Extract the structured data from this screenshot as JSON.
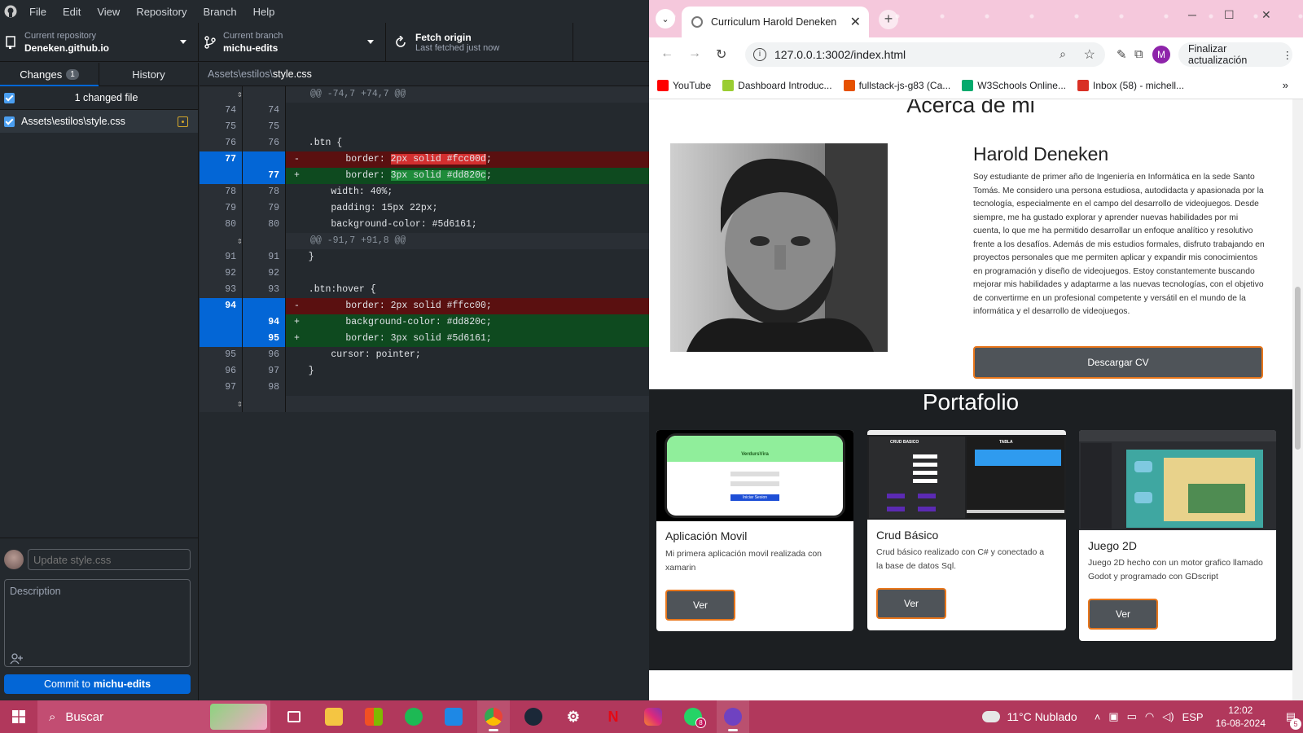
{
  "github_desktop": {
    "menu": [
      "File",
      "Edit",
      "View",
      "Repository",
      "Branch",
      "Help"
    ],
    "repo": {
      "label": "Current repository",
      "value": "Deneken.github.io"
    },
    "branch": {
      "label": "Current branch",
      "value": "michu-edits"
    },
    "fetch": {
      "label": "Fetch origin",
      "sub": "Last fetched just now"
    },
    "tabs": {
      "changes": "Changes",
      "changes_count": "1",
      "history": "History"
    },
    "changed_summary": "1 changed file",
    "file": "Assets\\estilos\\style.css",
    "diff_path": {
      "dir": "Assets\\estilos\\",
      "file": "style.css"
    },
    "commit": {
      "summary_placeholder": "Update style.css",
      "description_placeholder": "Description",
      "button_prefix": "Commit to",
      "button_branch": "michu-edits"
    },
    "diff_lines": [
      {
        "type": "hunk",
        "old": "",
        "new": "",
        "text": "@@ -74,7 +74,7 @@"
      },
      {
        "type": "ctx",
        "old": "74",
        "new": "74",
        "text": ""
      },
      {
        "type": "ctx",
        "old": "75",
        "new": "75",
        "text": ""
      },
      {
        "type": "ctx",
        "old": "76",
        "new": "76",
        "text": "  .btn {"
      },
      {
        "type": "del",
        "old": "77",
        "new": "",
        "pre": "      border: ",
        "hl": "2px solid #fcc00d",
        "post": ";"
      },
      {
        "type": "add",
        "old": "",
        "new": "77",
        "pre": "      border: ",
        "hl": "3px solid #dd820c",
        "post": ";"
      },
      {
        "type": "ctx",
        "old": "78",
        "new": "78",
        "text": "      width: 40%;"
      },
      {
        "type": "ctx",
        "old": "79",
        "new": "79",
        "text": "      padding: 15px 22px;"
      },
      {
        "type": "ctx",
        "old": "80",
        "new": "80",
        "text": "      background-color: #5d6161;"
      },
      {
        "type": "hunk",
        "old": "",
        "new": "",
        "text": "@@ -91,7 +91,8 @@"
      },
      {
        "type": "ctx",
        "old": "91",
        "new": "91",
        "text": "  }"
      },
      {
        "type": "ctx",
        "old": "92",
        "new": "92",
        "text": ""
      },
      {
        "type": "ctx",
        "old": "93",
        "new": "93",
        "text": "  .btn:hover {"
      },
      {
        "type": "del",
        "old": "94",
        "new": "",
        "pre": "      border: 2px solid #ffcc00;",
        "hl": "",
        "post": ""
      },
      {
        "type": "add",
        "old": "",
        "new": "94",
        "pre": "      background-color: #dd820c;",
        "hl": "",
        "post": ""
      },
      {
        "type": "add",
        "old": "",
        "new": "95",
        "pre": "      border: 3px solid #5d6161;",
        "hl": "",
        "post": ""
      },
      {
        "type": "ctx",
        "old": "95",
        "new": "96",
        "text": "      cursor: pointer;"
      },
      {
        "type": "ctx",
        "old": "96",
        "new": "97",
        "text": "  }"
      },
      {
        "type": "ctx",
        "old": "97",
        "new": "98",
        "text": ""
      },
      {
        "type": "hunk",
        "old": "",
        "new": "",
        "text": ""
      }
    ]
  },
  "chrome": {
    "tab_title": "Curriculum Harold Deneken",
    "url": "127.0.0.1:3002/index.html",
    "profile_initial": "M",
    "update_label": "Finalizar actualización",
    "bookmarks": [
      {
        "label": "YouTube",
        "color": "#ff0000"
      },
      {
        "label": "Dashboard Introduc...",
        "color": "#9acd32"
      },
      {
        "label": "fullstack-js-g83 (Ca...",
        "color": "#e65100"
      },
      {
        "label": "W3Schools Online...",
        "color": "#04aa6d"
      },
      {
        "label": "Inbox (58) - michell...",
        "color": "#d93025"
      }
    ],
    "more": "»"
  },
  "page": {
    "about_title": "Acerca de mi",
    "name": "Harold Deneken",
    "bio": "Soy estudiante de primer año de Ingeniería en Informática en la sede Santo Tomás. Me considero una persona estudiosa, autodidacta y apasionada por la tecnología, especialmente en el campo del desarrollo de videojuegos. Desde siempre, me ha gustado explorar y aprender nuevas habilidades por mi cuenta, lo que me ha permitido desarrollar un enfoque analítico y resolutivo frente a los desafíos. Además de mis estudios formales, disfruto trabajando en proyectos personales que me permiten aplicar y expandir mis conocimientos en programación y diseño de videojuegos. Estoy constantemente buscando mejorar mis habilidades y adaptarme a las nuevas tecnologías, con el objetivo de convertirme en un profesional competente y versátil en el mundo de la informática y el desarrollo de videojuegos.",
    "cv_button": "Descargar CV",
    "portfolio_title": "Portafolio",
    "cards": [
      {
        "title": "Aplicación Movil",
        "desc": "Mi primera aplicación movil realizada con xamarin",
        "button": "Ver",
        "thumb_brand": "VerdursVira",
        "thumb_button": "Iniciar Sesion"
      },
      {
        "title": "Crud Básico",
        "desc": "Crud básico realizado con C# y conectado a la base de datos Sql.",
        "button": "Ver",
        "thumb_left": "CRUD BASICO",
        "thumb_right": "TABLA"
      },
      {
        "title": "Juego 2D",
        "desc": "Juego 2D hecho con un motor grafico llamado Godot y programado con GDscript",
        "button": "Ver"
      }
    ]
  },
  "taskbar": {
    "search": "Buscar",
    "weather": "11°C  Nublado",
    "lang": "ESP",
    "time": "12:02",
    "date": "16-08-2024",
    "whatsapp_badge": "8",
    "notif_badge": "5"
  }
}
